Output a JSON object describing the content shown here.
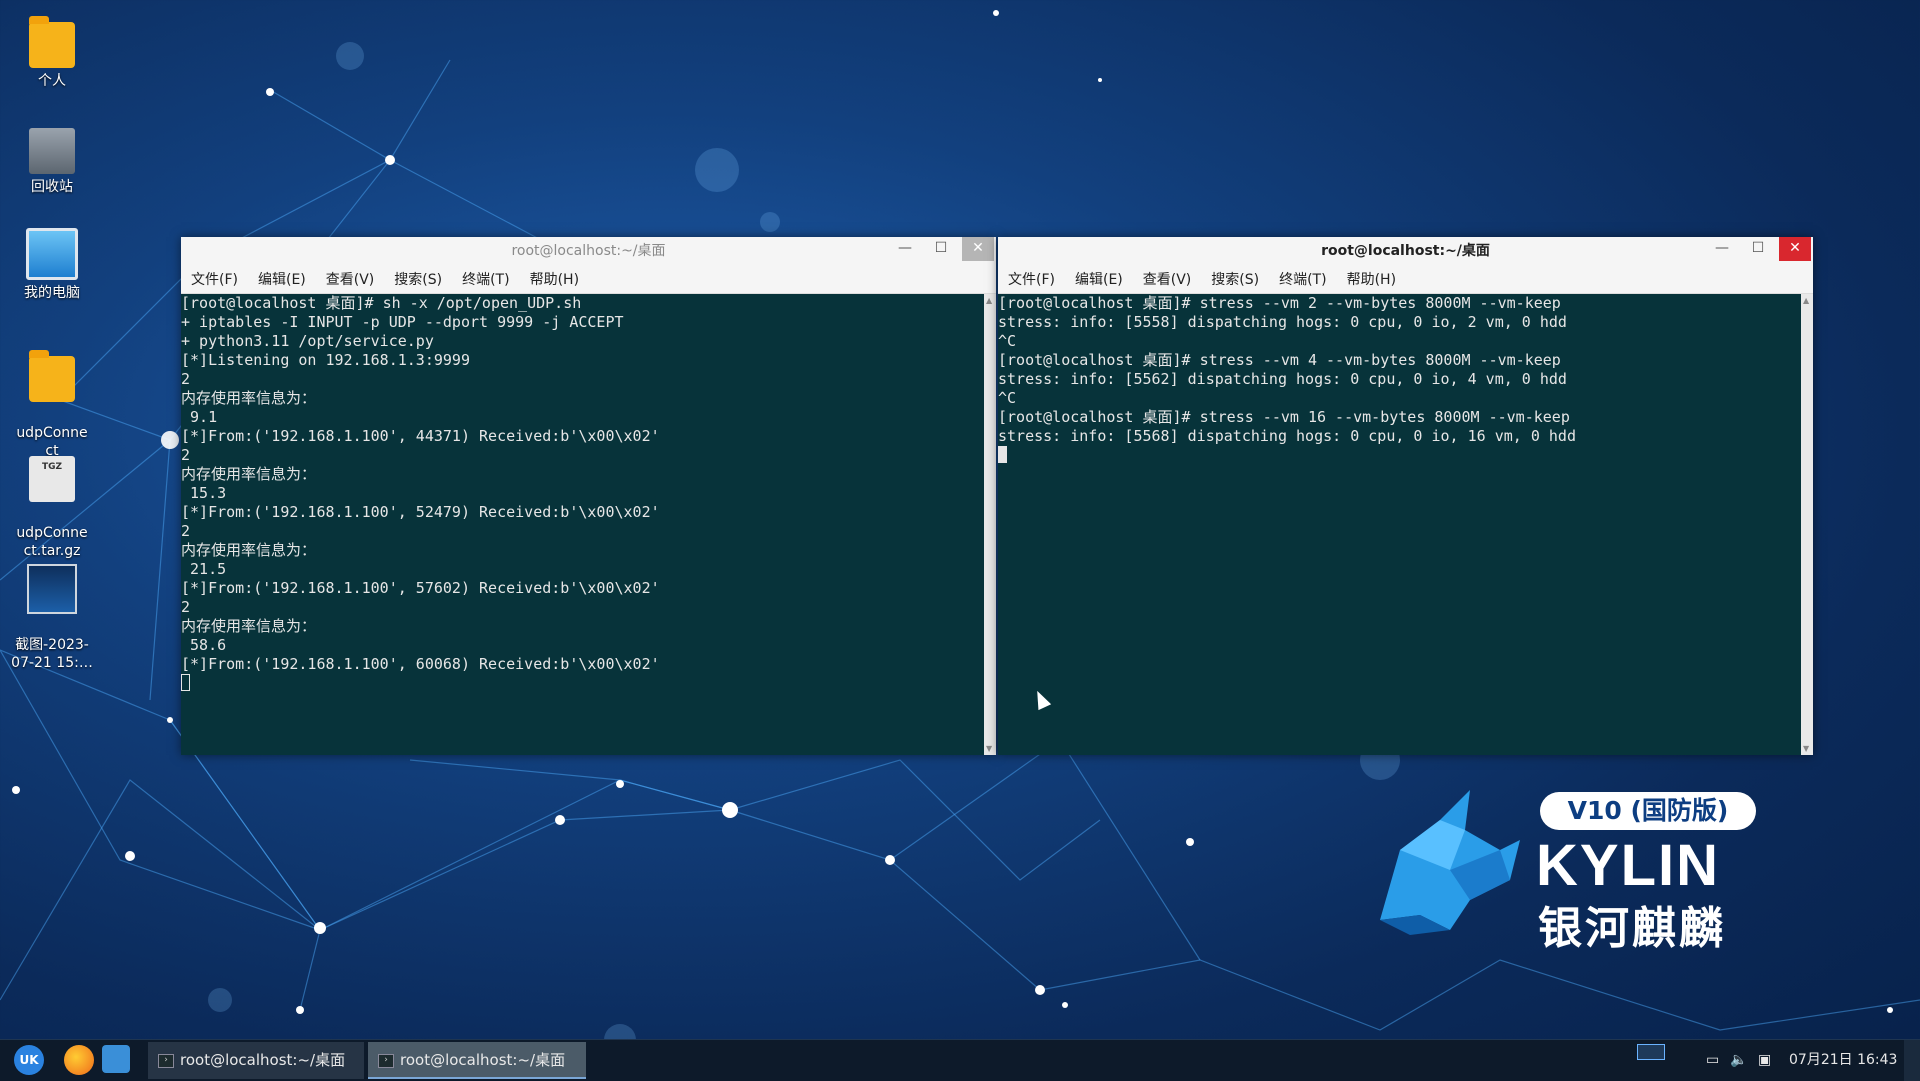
{
  "desktop": {
    "icons": [
      {
        "label": "个人",
        "icon": "folder-icon"
      },
      {
        "label": "回收站",
        "icon": "trash-icon"
      },
      {
        "label": "我的电脑",
        "icon": "computer-icon"
      },
      {
        "label": "udpConne\nct",
        "icon": "folder-icon"
      },
      {
        "label": "udpConne\nct.tar.gz",
        "icon": "archive-icon"
      },
      {
        "label": "截图-2023-\n07-21 15:…",
        "icon": "image-icon"
      }
    ],
    "archive_tag": "TGZ"
  },
  "window_left": {
    "title": "root@localhost:~/桌面",
    "menu": [
      "文件(F)",
      "编辑(E)",
      "查看(V)",
      "搜索(S)",
      "终端(T)",
      "帮助(H)"
    ],
    "lines": [
      "[root@localhost 桌面]# sh -x /opt/open_UDP.sh",
      "+ iptables -I INPUT -p UDP --dport 9999 -j ACCEPT",
      "+ python3.11 /opt/service.py",
      "[*]Listening on 192.168.1.3:9999",
      "2",
      "内存使用率信息为：",
      " 9.1",
      "[*]From:('192.168.1.100', 44371) Received:b'\\x00\\x02'",
      "2",
      "内存使用率信息为：",
      " 15.3",
      "[*]From:('192.168.1.100', 52479) Received:b'\\x00\\x02'",
      "2",
      "内存使用率信息为：",
      " 21.5",
      "[*]From:('192.168.1.100', 57602) Received:b'\\x00\\x02'",
      "2",
      "内存使用率信息为：",
      " 58.6",
      "[*]From:('192.168.1.100', 60068) Received:b'\\x00\\x02'"
    ]
  },
  "window_right": {
    "title": "root@localhost:~/桌面",
    "menu": [
      "文件(F)",
      "编辑(E)",
      "查看(V)",
      "搜索(S)",
      "终端(T)",
      "帮助(H)"
    ],
    "lines": [
      "[root@localhost 桌面]# stress --vm 2 --vm-bytes 8000M --vm-keep",
      "stress: info: [5558] dispatching hogs: 0 cpu, 0 io, 2 vm, 0 hdd",
      "^C",
      "[root@localhost 桌面]# stress --vm 4 --vm-bytes 8000M --vm-keep",
      "stress: info: [5562] dispatching hogs: 0 cpu, 0 io, 4 vm, 0 hdd",
      "^C",
      "[root@localhost 桌面]# stress --vm 16 --vm-bytes 8000M --vm-keep",
      "stress: info: [5568] dispatching hogs: 0 cpu, 0 io, 16 vm, 0 hdd"
    ]
  },
  "logo": {
    "badge": "V10 (国防版)",
    "word": "KYLIN",
    "cn": "银河麒麟"
  },
  "taskbar": {
    "buttons": [
      "root@localhost:~/桌面",
      "root@localhost:~/桌面"
    ],
    "start_label": "UK",
    "clock": "07月21日 16:43"
  }
}
